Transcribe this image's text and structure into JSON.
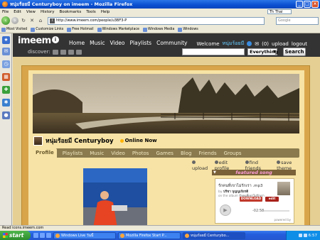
{
  "window": {
    "title": "หนุ่มร้อยมี Centuryboy on imeem - Mozilla Firefox"
  },
  "menu": [
    "File",
    "Edit",
    "View",
    "History",
    "Bookmarks",
    "Tools",
    "Help"
  ],
  "language_selector": "Th Thai",
  "address": {
    "url": "http://www.imeem.com/people/u3BF3-P"
  },
  "browser_search": {
    "placeholder": "Google"
  },
  "bookmarks": [
    "Most Visited",
    "Customize Links",
    "Free Hotmail",
    "Windows Marketplace",
    "Windows Media",
    "Windows"
  ],
  "imeem": {
    "logo": "imeem",
    "nav": [
      "Home",
      "Music",
      "Video",
      "Playlists",
      "Community"
    ],
    "welcome": "Welcome",
    "username": "หนุ่มร้อยมี",
    "message_count": "(0)",
    "upload": "upload",
    "logout": "logout",
    "discover": "discover:",
    "search_scope": "Everything",
    "search_button": "Search"
  },
  "profile": {
    "name": "หนุ่มร้อยมี Centuryboy",
    "status": "Online Now",
    "tabs": [
      "Profile",
      "Playlists",
      "Music",
      "Video",
      "Photos",
      "Games",
      "Blog",
      "Friends",
      "Groups"
    ],
    "active_tab": "Profile",
    "actions": [
      "upload",
      "edit profile",
      "find friends",
      "save theme"
    ]
  },
  "featured": {
    "header": "featured song",
    "title": "รักคนที่เขาไม่รักเรา .mp3",
    "by_label": "by",
    "artist": "ปรีชา บุญญเกียรติ",
    "album_label": "on the album",
    "album": "รักคนที่เขาไม่รักเรา",
    "download": "DOWNLOAD",
    "edit": "edit",
    "time": "-02:58",
    "powered_by": "powered by"
  },
  "statusbar": "Read icons.imeem.com",
  "taskbar": {
    "start": "start",
    "tasks": [
      "Windows Live วันนี้",
      "Mozilla Firefox Start P...",
      "หนุ่มร้อยมี Centurybo..."
    ],
    "clock": "6:57"
  },
  "colors": {
    "xp_blue": "#0a4fd0",
    "imeem_bar": "#333333",
    "profile_bg": "#f7e3a5",
    "frame": "#d9a54b"
  }
}
